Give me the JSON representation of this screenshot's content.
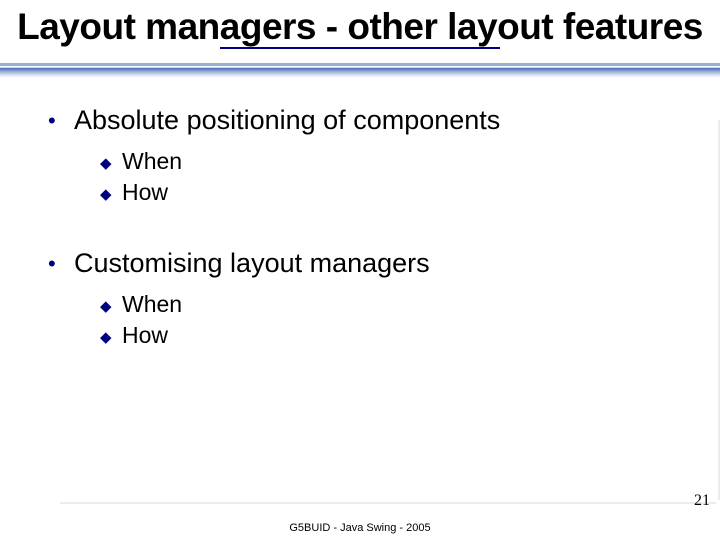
{
  "slide": {
    "title": "Layout managers - other layout features",
    "bullets": [
      {
        "text": "Absolute positioning of components",
        "sub": [
          "When",
          "How"
        ]
      },
      {
        "text": "Customising layout managers",
        "sub": [
          "When",
          "How"
        ]
      }
    ],
    "page_number": "21",
    "footer": "G5BUID - Java Swing - 2005"
  }
}
